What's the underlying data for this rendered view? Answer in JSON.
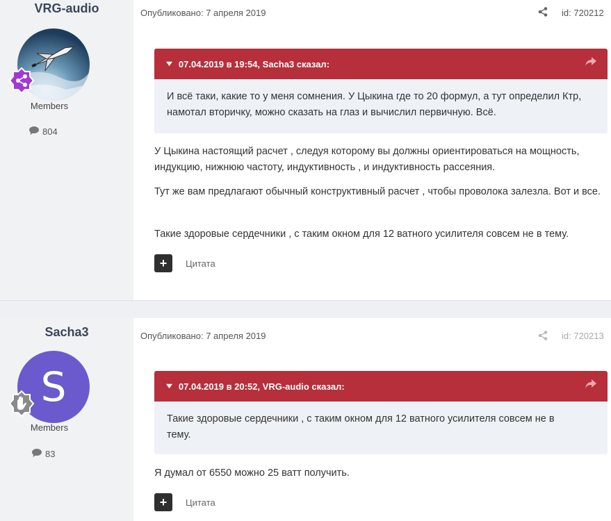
{
  "posts": [
    {
      "author": "VRG-audio",
      "group": "Members",
      "post_count": "804",
      "published": "Опубликовано: 7 апреля 2019",
      "post_id": "id: 720212",
      "quote_header": "07.04.2019 в 19:54, Sacha3 сказал:",
      "quote_text": "И всё таки, какие то у меня сомнения. У Цыкина где то 20 формул, а тут определил Ктр, намотал вторичку, можно сказать на глаз и вычислил первичную. Всё.",
      "paragraphs": [
        "У Цыкина настоящий расчет , следуя которому вы должны ориентироваться на мощность, индукцию, нижнюю частоту, индуктивность , и индуктивность рассеяния.",
        "Тут же вам предлагают обычный конструктивный расчет , чтобы проволока залезла. Вот и все.",
        "Такие здоровые сердечники , с таким окном для 12 ватного усилителя совсем не в тему."
      ],
      "cite_label": "Цитата"
    },
    {
      "author": "Sacha3",
      "avatar_letter": "S",
      "group": "Members",
      "post_count": "83",
      "published": "Опубликовано: 7 апреля 2019",
      "post_id": "id: 720213",
      "quote_header": "07.04.2019 в 20:52, VRG-audio сказал:",
      "quote_text": "Такие здоровые сердечники , с таким окном для 12 ватного усилителя совсем не в тему.",
      "paragraphs": [
        "Я думал от 6550 можно 25 ватт получить."
      ],
      "cite_label": "Цитата"
    }
  ],
  "icons": {
    "share": "share-icon",
    "comment": "comment-icon",
    "reply_arrow": "reply-arrow-icon",
    "plus": "plus-icon"
  },
  "colors": {
    "quote_header": "#b62f3b",
    "author_bg": "#f1f2f4",
    "avatar_letter_bg": "#6a5acd",
    "badge_purple": "#a33ad0",
    "badge_grey": "#8a8a8a"
  }
}
